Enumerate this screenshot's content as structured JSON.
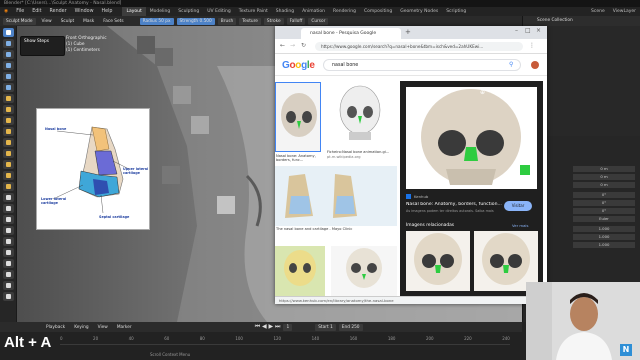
{
  "titlebar": {
    "text": "Blender* [C:\\Users\\...\\Sculpt Anatomy - Nasal.blend]"
  },
  "topbar": {
    "menus": [
      "File",
      "Edit",
      "Render",
      "Window",
      "Help"
    ],
    "workspaces": [
      "Layout",
      "Modeling",
      "Sculpting",
      "UV Editing",
      "Texture Paint",
      "Shading",
      "Animation",
      "Rendering",
      "Compositing",
      "Geometry Nodes",
      "Scripting"
    ],
    "active_workspace": "Layout",
    "scene": "Scene",
    "view_layer": "ViewLayer"
  },
  "header2": {
    "mode": "Sculpt Mode",
    "items": [
      "View",
      "Sculpt",
      "Mask",
      "Face Sets"
    ],
    "tools": [
      "Brush",
      "Texture",
      "Stroke",
      "Falloff",
      "Cursor"
    ],
    "radius_label": "Radius",
    "radius_value": "50 px",
    "strength_label": "Strength",
    "strength_value": "0.500"
  },
  "dropdown": {
    "title": "Show Steps",
    "items": [
      "Front Orthographic",
      "(1) Cube",
      "(1) Centimeters"
    ]
  },
  "reference": {
    "labels": {
      "nasal_bone": "Nasal bone",
      "upper_lateral": "Upper lateral cartilage",
      "lower_lateral": "Lower lateral cartilage",
      "septal": "Septal cartilage"
    }
  },
  "chrome": {
    "tab_title": "nasal bone - Pesquisa Google",
    "url": "https://www.google.com/search?q=nasal+bone&tbm=isch&ved=2ahUKEwi...",
    "search_query": "nasal bone",
    "results": [
      {
        "caption": "Nasal bone: Anatomy, borders, func..."
      },
      {
        "caption": "Ficheiro:Nasal bone animation.gi...",
        "source": "pt.m.wikipedia.org"
      },
      {
        "caption": "The nasal bone and cartilage - Mayo Clinic"
      }
    ],
    "preview": {
      "source": "Kenhub",
      "title": "Nasal bone: Anatomy, borders, function...",
      "subtitle": "As imagens podem ter direitos autorais. Saiba mais",
      "visit_label": "Visitar",
      "related_label": "Imagens relacionadas",
      "see_more": "Ver mais"
    },
    "status_url": "https://www.kenhub.com/en/library/anatomy/the-nasal-bone"
  },
  "rightpanel": {
    "outliner_title": "Scene Collection",
    "values": [
      "0 m",
      "0 m",
      "0 m",
      "0°",
      "0°",
      "0°",
      "1.000",
      "1.000",
      "1.000"
    ],
    "mode_label": "Euler"
  },
  "timeline": {
    "menus": [
      "Playback",
      "Keying",
      "View",
      "Marker"
    ],
    "current_frame": "1",
    "start_label": "Start",
    "start": "1",
    "end_label": "End",
    "end": "250",
    "ticks": [
      "0",
      "20",
      "40",
      "60",
      "80",
      "100",
      "120",
      "140",
      "160",
      "180",
      "200",
      "220",
      "240"
    ],
    "status_text": "Scroll Context Menu"
  },
  "overlay": {
    "text": "Alt + A"
  },
  "webcam": {
    "badge": "N"
  },
  "colors": {
    "accent": "#4d82c7",
    "google_blue": "#4285f4",
    "google_red": "#ea4335",
    "google_yellow": "#fbbc05",
    "google_green": "#34a853",
    "bone_highlight": "#2ecc40"
  }
}
